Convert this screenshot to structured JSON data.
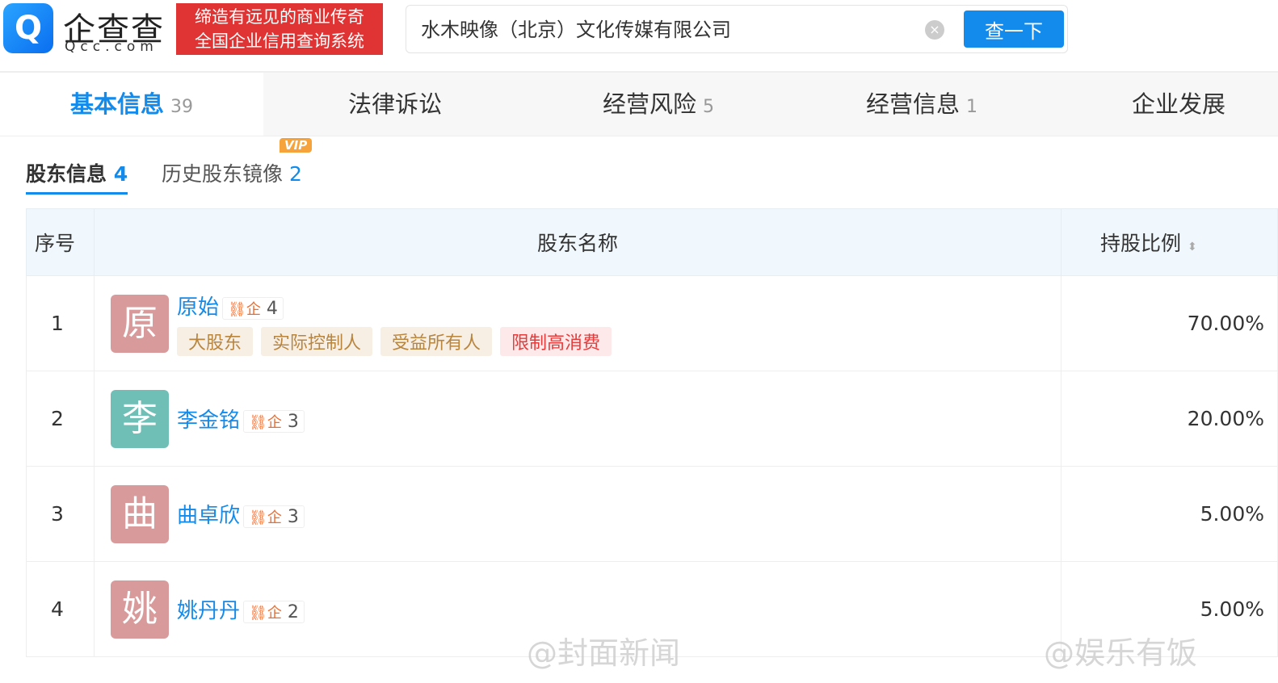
{
  "header": {
    "logo_text": "企查查",
    "logo_sub": "Qcc.com",
    "slogan_1": "缔造有远见的商业传奇",
    "slogan_2": "全国企业信用查询系统",
    "search_value": "水木映像（北京）文化传媒有限公司",
    "search_button": "查一下"
  },
  "tabs": [
    {
      "label": "基本信息",
      "count": "39"
    },
    {
      "label": "法律诉讼",
      "count": ""
    },
    {
      "label": "经营风险",
      "count": "5"
    },
    {
      "label": "经营信息",
      "count": "1"
    },
    {
      "label": "企业发展",
      "count": ""
    }
  ],
  "subtabs": [
    {
      "label": "股东信息",
      "count": "4"
    },
    {
      "label": "历史股东镜像",
      "count": "2",
      "badge": "VIP"
    }
  ],
  "table": {
    "headers": [
      "序号",
      "股东名称",
      "持股比例"
    ],
    "rows": [
      {
        "idx": "1",
        "avatar": "原",
        "name": "原始",
        "rel": "4",
        "pct": "70.00%",
        "color": "#d99a9b",
        "tags": [
          "大股东",
          "实际控制人",
          "受益所有人",
          "限制高消费"
        ]
      },
      {
        "idx": "2",
        "avatar": "李",
        "name": "李金铭",
        "rel": "3",
        "pct": "20.00%",
        "color": "#70bfb6",
        "tags": []
      },
      {
        "idx": "3",
        "avatar": "曲",
        "name": "曲卓欣",
        "rel": "3",
        "pct": "5.00%",
        "color": "#d99a9b",
        "tags": []
      },
      {
        "idx": "4",
        "avatar": "姚",
        "name": "姚丹丹",
        "rel": "2",
        "pct": "5.00%",
        "color": "#d99a9b",
        "tags": []
      }
    ]
  },
  "watermarks": [
    "@封面新闻",
    "@娱乐有饭"
  ]
}
